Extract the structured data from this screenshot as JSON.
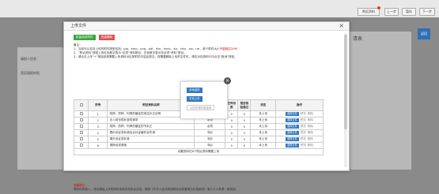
{
  "topbar": {
    "buttons": [
      {
        "label": "附近资料"
      },
      {
        "label": "上一步"
      },
      {
        "label": "暂存"
      },
      {
        "label": "下一步"
      }
    ]
  },
  "background": {
    "left_label_1": "填报人信息",
    "left_label_2": "是否填报申报",
    "right_title": "清表",
    "blue_side": "返回"
  },
  "modal": {
    "title": "上传文件",
    "close": "×",
    "btn_batch": "批量添加附件",
    "btn_delete": "批量删除",
    "notes_title": "备注：",
    "note1_a": "1、当前可以支持上传的附件类型包括：jpg、bmp、png、pdf、doc、docx、xls、xlsx、zip、rar，单个附件大小",
    "note1_b": "不能超过20M",
    "note2": "2、“附近资料”按钮上的红色数字表示“必须”资料数目，白色数字表示非必须“资料”数目。",
    "note3": "3、请点击上传“+”按钮选择需要上传资料对应的附件内容后提交，将需要删除上传的文件时，请在对应资料行中点击“取消”按钮。",
    "table": {
      "headers": [
        "",
        "序号",
        "附近资料名称",
        "是否必要",
        "已传份数",
        "是否核验通过",
        "状态",
        "操作"
      ],
      "rows": [
        {
          "no": "1",
          "name": "抵押、质押、列押的缓证的或住补正证明",
          "required": "必须",
          "count": "0",
          "verified": "0",
          "status": "未上传"
        },
        {
          "no": "2",
          "name": "法人或也现补遗或请求",
          "required": "必须",
          "count": "0",
          "verified": "0",
          "status": "未上传"
        },
        {
          "no": "3",
          "name": "抵押、质押、列押的缓证的书补正",
          "required": "必须",
          "count": "0",
          "verified": "0",
          "status": "未上传"
        },
        {
          "no": "4",
          "name": "理价设证或补遗及合补证缓件证件请",
          "required": "非必",
          "count": "0",
          "verified": "0",
          "status": "未上传"
        },
        {
          "no": "5",
          "name": "课外设证或补遗",
          "required": "非必",
          "count": "0",
          "verified": "0",
          "status": "未上传"
        },
        {
          "no": "6",
          "name": "请换设或请遗",
          "required": "非必",
          "count": "0",
          "verified": "0",
          "status": "未上传"
        }
      ],
      "op_upload": "选择文件",
      "op_view": "预览",
      "op_delete": "删除",
      "footer": "设置资料在6个附近资料需要上传"
    },
    "tips_title": "温馨提示：",
    "tips_text": "需到的附报人，请切确保上传的资料或真实性和合法性。按照《中华人民共和国税收征收管理法实施细则》第九十六条第一款规定："
  },
  "popup": {
    "close": "×",
    "btn_local": "本地选择",
    "btn_phone": "手机上传",
    "btn_history": "从历史资料库选择"
  }
}
